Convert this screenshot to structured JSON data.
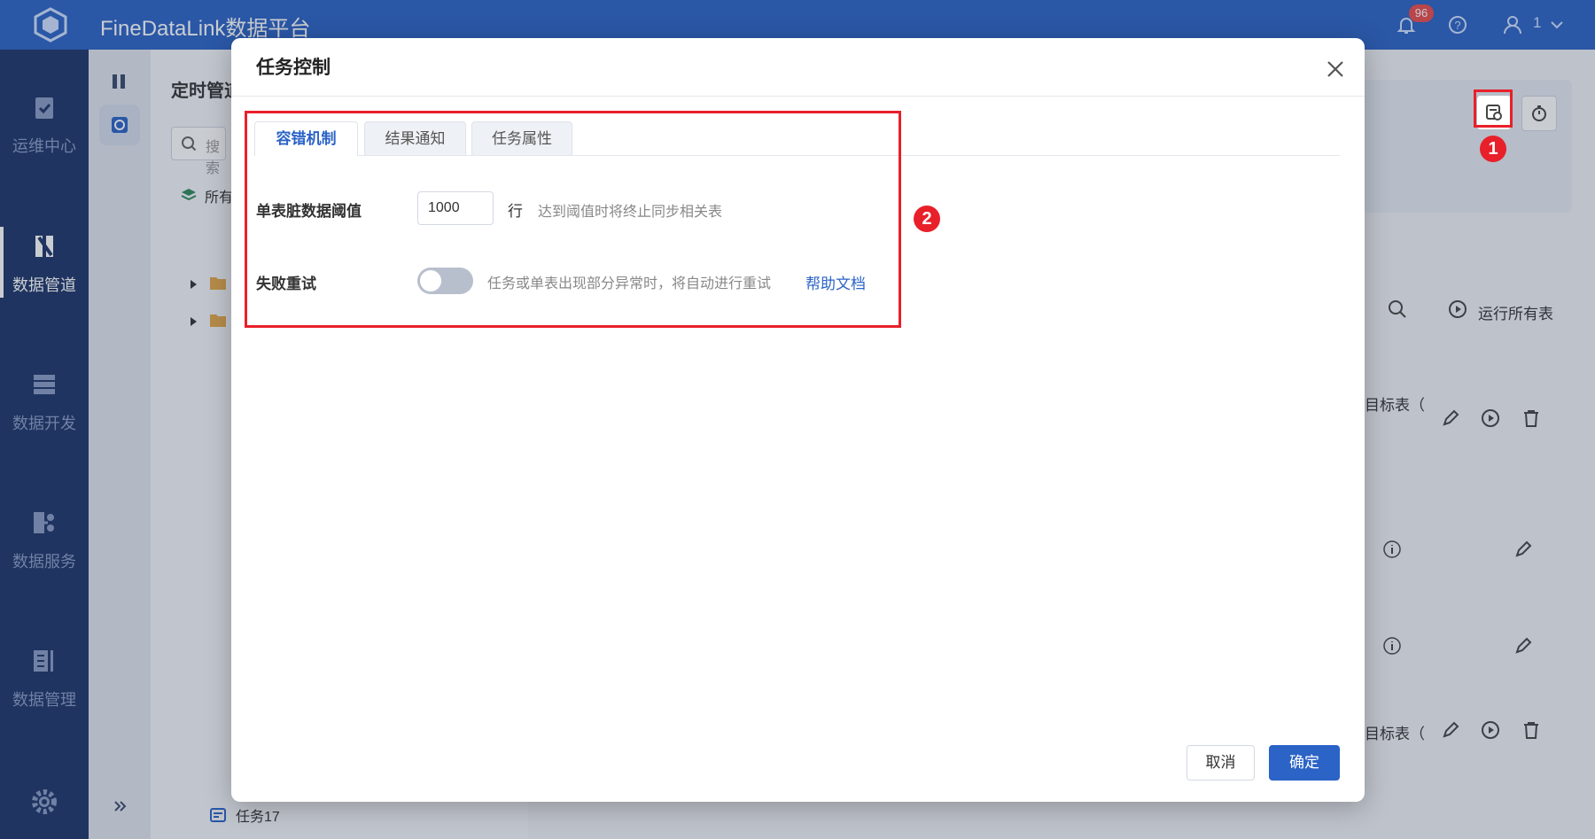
{
  "app": {
    "title": "FineDataLink数据平台",
    "notification_count": "96",
    "user_name": "1"
  },
  "left_nav": {
    "items": [
      {
        "label": "运维中心",
        "icon": "clipboard-check-icon"
      },
      {
        "label": "数据管道",
        "icon": "pipeline-icon"
      },
      {
        "label": "数据开发",
        "icon": "database-stack-icon"
      },
      {
        "label": "数据服务",
        "icon": "api-service-icon"
      },
      {
        "label": "数据管理",
        "icon": "data-management-icon"
      }
    ],
    "active_index": 1
  },
  "tree_panel": {
    "title": "定时管道",
    "search_placeholder": "搜索",
    "root_label": "所有",
    "last_item": "任务17"
  },
  "background": {
    "run_all_label": "运行所有表",
    "target_table_label": "目标表（"
  },
  "annotations": {
    "marker_1": "1",
    "marker_2": "2",
    "highlight_color": "#e8202a"
  },
  "modal": {
    "title": "任务控制",
    "tabs": [
      {
        "label": "容错机制",
        "active": true
      },
      {
        "label": "结果通知",
        "active": false
      },
      {
        "label": "任务属性",
        "active": false
      }
    ],
    "fields": {
      "threshold": {
        "label": "单表脏数据阈值",
        "value": "1000",
        "unit": "行",
        "hint": "达到阈值时将终止同步相关表"
      },
      "retry": {
        "label": "失败重试",
        "enabled": false,
        "hint": "任务或单表出现部分异常时，将自动进行重试",
        "help_link": "帮助文档"
      }
    },
    "buttons": {
      "cancel": "取消",
      "ok": "确定"
    }
  },
  "colors": {
    "primary": "#2b63c6",
    "nav_bg": "#1d3469",
    "danger": "#e8202a"
  }
}
